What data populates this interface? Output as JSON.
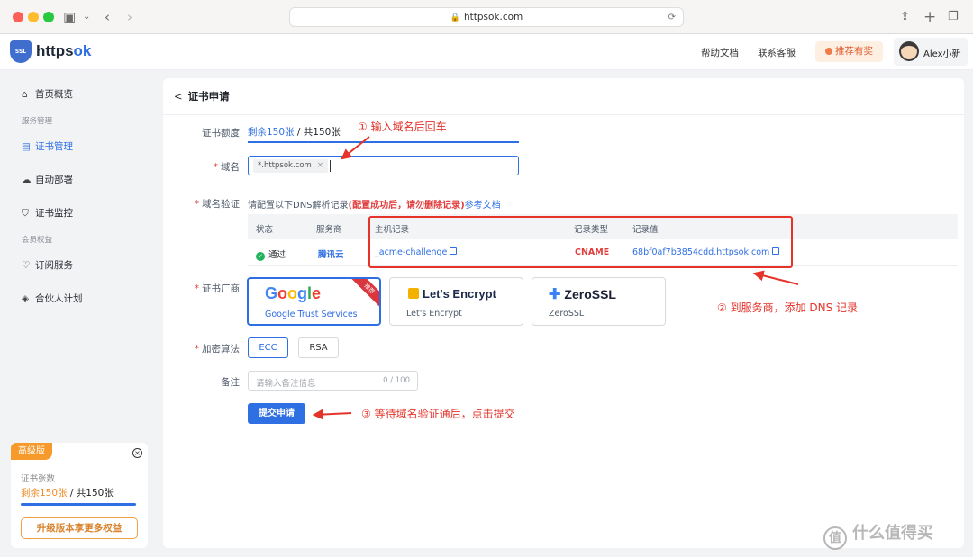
{
  "browser": {
    "url": "httpsok.com"
  },
  "header": {
    "brand_prefix": "https",
    "brand_suffix": "ok",
    "logo_text": "SSL",
    "nav": [
      "帮助文档",
      "联系客服"
    ],
    "promo": "推荐有奖",
    "user": "Alex小新"
  },
  "sidebar": {
    "items": [
      {
        "label": "首页概览",
        "icon": "home-icon"
      },
      {
        "group": "服务管理"
      },
      {
        "label": "证书管理",
        "icon": "certificate-icon",
        "active": true
      },
      {
        "label": "自动部署",
        "icon": "deploy-icon"
      },
      {
        "label": "证书监控",
        "icon": "shield-icon"
      },
      {
        "group": "会员权益"
      },
      {
        "label": "订阅服务",
        "icon": "heart-icon"
      },
      {
        "label": "合伙人计划",
        "icon": "handshake-icon"
      }
    ],
    "upsell": {
      "tier": "高级版",
      "label": "证书张数",
      "remaining": "剩余150张",
      "total": " / 共150张",
      "button": "升级版本享更多权益"
    }
  },
  "main": {
    "back_title": "证书申请",
    "quota": {
      "label": "证书额度",
      "remaining": "剩余150张",
      "total": " / 共150张"
    },
    "domain": {
      "label": "域名",
      "tag": "*.httpsok.com"
    },
    "verify": {
      "label": "域名验证",
      "text_prefix": "请配置以下DNS解析记录",
      "text_warn": "(配置成功后，请勿删除记录)",
      "link": "参考文档",
      "headers": [
        "状态",
        "服务商",
        "主机记录",
        "记录类型",
        "记录值"
      ],
      "row": {
        "status": "通过",
        "provider": "腾讯云",
        "host": "_acme-challenge",
        "type": "CNAME",
        "value": "68bf0af7b3854cdd.httpsok.com"
      }
    },
    "vendor": {
      "label": "证书厂商",
      "options": [
        {
          "logo": "Google",
          "name": "Google Trust Services",
          "badge": "推荐",
          "selected": true
        },
        {
          "logo": "Let's Encrypt",
          "name": "Let's Encrypt",
          "selected": false
        },
        {
          "logo": "ZeroSSL",
          "name": "ZeroSSL",
          "selected": false
        }
      ]
    },
    "algorithm": {
      "label": "加密算法",
      "options": [
        "ECC",
        "RSA"
      ],
      "selected": "ECC"
    },
    "note": {
      "label": "备注",
      "placeholder": "请输入备注信息",
      "count": "0 / 100"
    },
    "submit": "提交申请"
  },
  "annotations": {
    "step1": "① 输入域名后回车",
    "step2": "② 到服务商，添加 DNS 记录",
    "step3": "③ 等待域名验证通后，点击提交"
  },
  "watermark": "什么值得买",
  "colors": {
    "accent": "#2f6fe4",
    "annotation": "#e5332a",
    "warning": "#e23b3b",
    "upsell": "#f59a2b"
  }
}
